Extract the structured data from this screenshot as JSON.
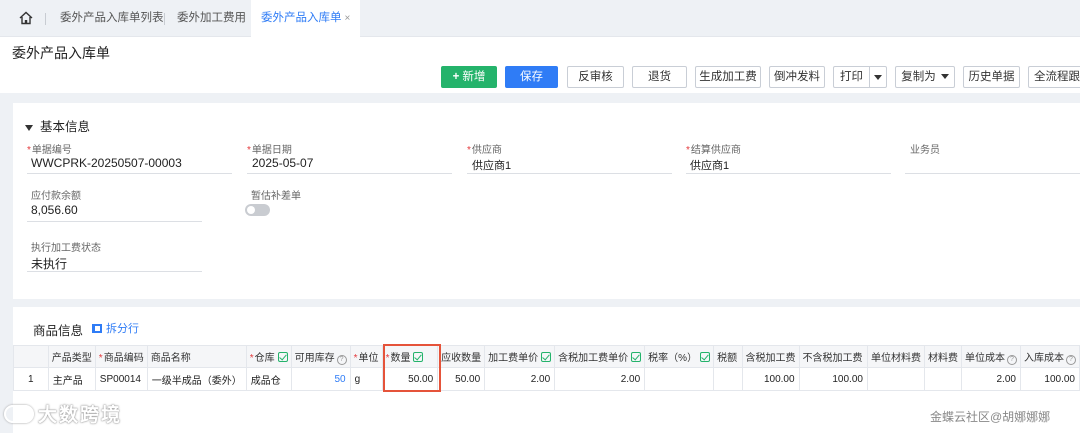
{
  "tabs": [
    {
      "label": "委外产品入库单列表"
    },
    {
      "label": "委外加工费用"
    },
    {
      "label": "委外产品入库单",
      "close": "×"
    }
  ],
  "page_title": "委外产品入库单",
  "toolbar": {
    "new": "新增",
    "save": "保存",
    "unaudit": "反审核",
    "return": "退货",
    "gen_fee": "生成加工费",
    "reverse": "倒冲发料",
    "print": "打印",
    "copy_as": "复制为",
    "history": "历史单据",
    "trace": "全流程跟踪"
  },
  "basic": {
    "title": "基本信息",
    "fields": {
      "bill_no": {
        "label": "单据编号",
        "value": "WWCPRK-20250507-00003"
      },
      "bill_date": {
        "label": "单据日期",
        "value": "2025-05-07"
      },
      "supplier": {
        "label": "供应商",
        "value": "供应商1"
      },
      "settle_supplier": {
        "label": "结算供应商",
        "value": "供应商1"
      },
      "salesman": {
        "label": "业务员",
        "value": ""
      },
      "payable": {
        "label": "应付款余额",
        "value": "8,056.60"
      },
      "estimate": {
        "label": "暂估补差单"
      },
      "exec_status": {
        "label": "执行加工费状态",
        "value": "未执行"
      }
    }
  },
  "goods": {
    "title": "商品信息",
    "split_row": "拆分行",
    "columns": [
      {
        "label": ""
      },
      {
        "label": "产品类型"
      },
      {
        "label": "商品编码",
        "required": "*"
      },
      {
        "label": "商品名称"
      },
      {
        "label": "仓库",
        "required": "*",
        "check": true
      },
      {
        "label": "可用库存",
        "help": "?"
      },
      {
        "label": "单位",
        "required": "*"
      },
      {
        "label": "数量",
        "required": "*",
        "check": true
      },
      {
        "label": "应收数量"
      },
      {
        "label": "加工费单价",
        "check": true
      },
      {
        "label": "含税加工费单价",
        "check": true
      },
      {
        "label": "税率（%）",
        "check": true
      },
      {
        "label": "税额"
      },
      {
        "label": "含税加工费"
      },
      {
        "label": "不含税加工费"
      },
      {
        "label": "单位材料费"
      },
      {
        "label": "材料费"
      },
      {
        "label": "单位成本",
        "help": "?"
      },
      {
        "label": "入库成本",
        "help": "?"
      }
    ],
    "rows": [
      [
        "1",
        "主产品",
        "SP00014",
        "一级半成品（委外）",
        "成品仓",
        "50",
        "g",
        "50.00",
        "50.00",
        "2.00",
        "2.00",
        "",
        "",
        "100.00",
        "100.00",
        "",
        "",
        "2.00",
        "100.00"
      ]
    ]
  },
  "watermarks": {
    "left": "大数跨境",
    "right": "金蝶云社区@胡娜娜娜"
  },
  "colors": {
    "primary": "#2f7cf6",
    "green": "#24b36b",
    "highlight": "#e5533a",
    "required": "#e4393c"
  }
}
